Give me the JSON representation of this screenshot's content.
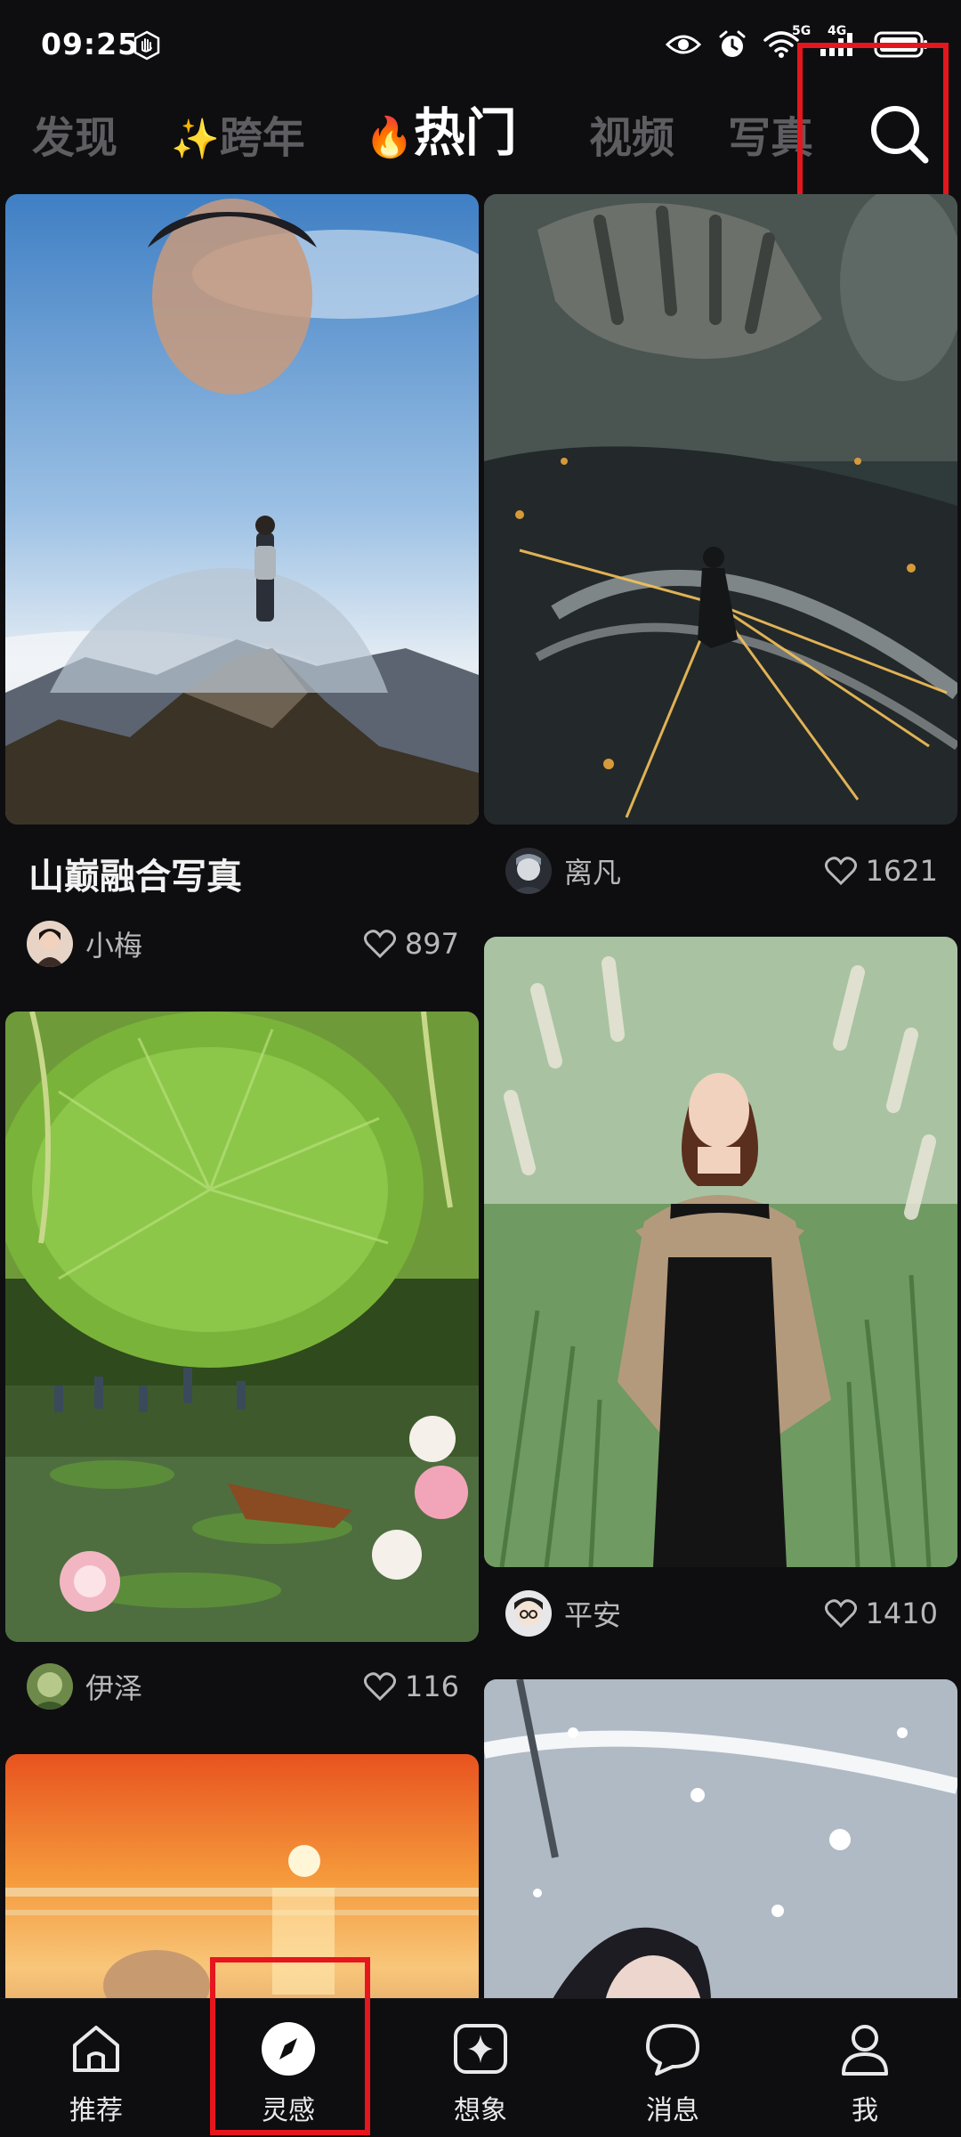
{
  "status_bar": {
    "time": "09:25",
    "left_icon": "hand-icon",
    "right_icons": [
      "eye-icon",
      "alarm-icon",
      "wifi-icon",
      "signal-icon",
      "battery-icon"
    ],
    "wifi_badge": "5G",
    "signal_badge": "4G"
  },
  "top_tabs": {
    "items": [
      {
        "label": "发现",
        "active": false
      },
      {
        "label": "跨年",
        "prefix": "✨",
        "active": false
      },
      {
        "label": "热门",
        "prefix": "🔥",
        "active": true
      },
      {
        "label": "视频",
        "active": false
      },
      {
        "label": "写真",
        "active": false
      }
    ],
    "search_icon": "search-icon"
  },
  "feed": {
    "left": [
      {
        "title": "山巅融合写真",
        "author": "小梅",
        "likes": "897",
        "image": "mountain-portrait"
      },
      {
        "author": "伊泽",
        "likes": "116",
        "image": "lotus-pond"
      },
      {
        "image": "sunset-beach"
      }
    ],
    "right": [
      {
        "author": "离凡",
        "likes": "1621",
        "image": "giant-hand"
      },
      {
        "author": "平安",
        "likes": "1410",
        "image": "woman-in-grass"
      },
      {
        "image": "snow-portrait"
      }
    ]
  },
  "bottom_nav": {
    "items": [
      {
        "label": "推荐",
        "icon": "home-icon"
      },
      {
        "label": "灵感",
        "icon": "compass-icon",
        "active": true
      },
      {
        "label": "想象",
        "icon": "sparkle-icon"
      },
      {
        "label": "消息",
        "icon": "chat-icon"
      },
      {
        "label": "我",
        "icon": "profile-icon"
      }
    ]
  },
  "colors": {
    "background": "#0e0e10",
    "highlight_box": "#e5161d",
    "inactive_tab": "#5d5d62"
  }
}
